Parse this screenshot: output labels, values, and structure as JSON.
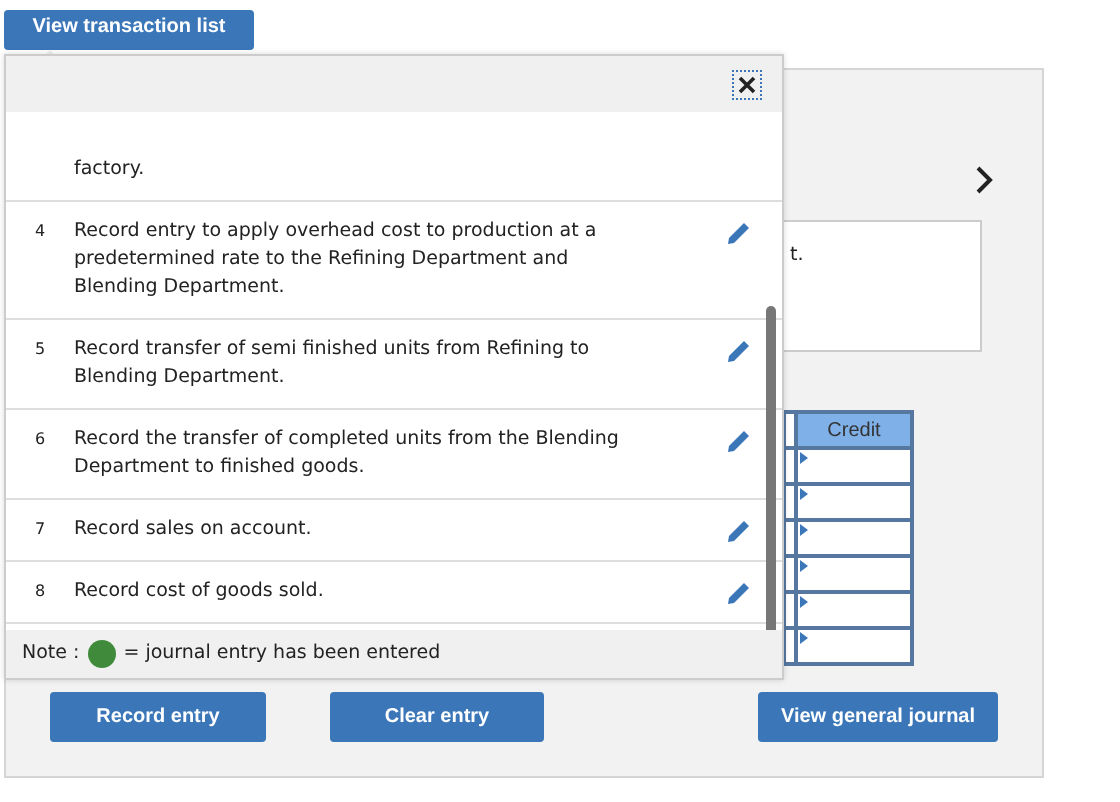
{
  "tab": {
    "label": "View transaction list"
  },
  "transactions": [
    {
      "text": "factory."
    },
    {
      "number": "4",
      "text": "Record entry to apply overhead cost to production at a predetermined rate to the Refining Department and Blending Department."
    },
    {
      "number": "5",
      "text": "Record transfer of semi finished units from Refining to Blending Department."
    },
    {
      "number": "6",
      "text": "Record the transfer of completed units from the Blending Department to finished goods."
    },
    {
      "number": "7",
      "text": "Record sales on account."
    },
    {
      "number": "8",
      "text": "Record cost of goods sold."
    }
  ],
  "note": {
    "label": "Note :",
    "text": "= journal entry has been entered"
  },
  "entry_description": "t.",
  "journal_table": {
    "columns": [
      "Credit"
    ]
  },
  "buttons": [
    "Record entry",
    "Clear entry",
    "View general journal"
  ]
}
